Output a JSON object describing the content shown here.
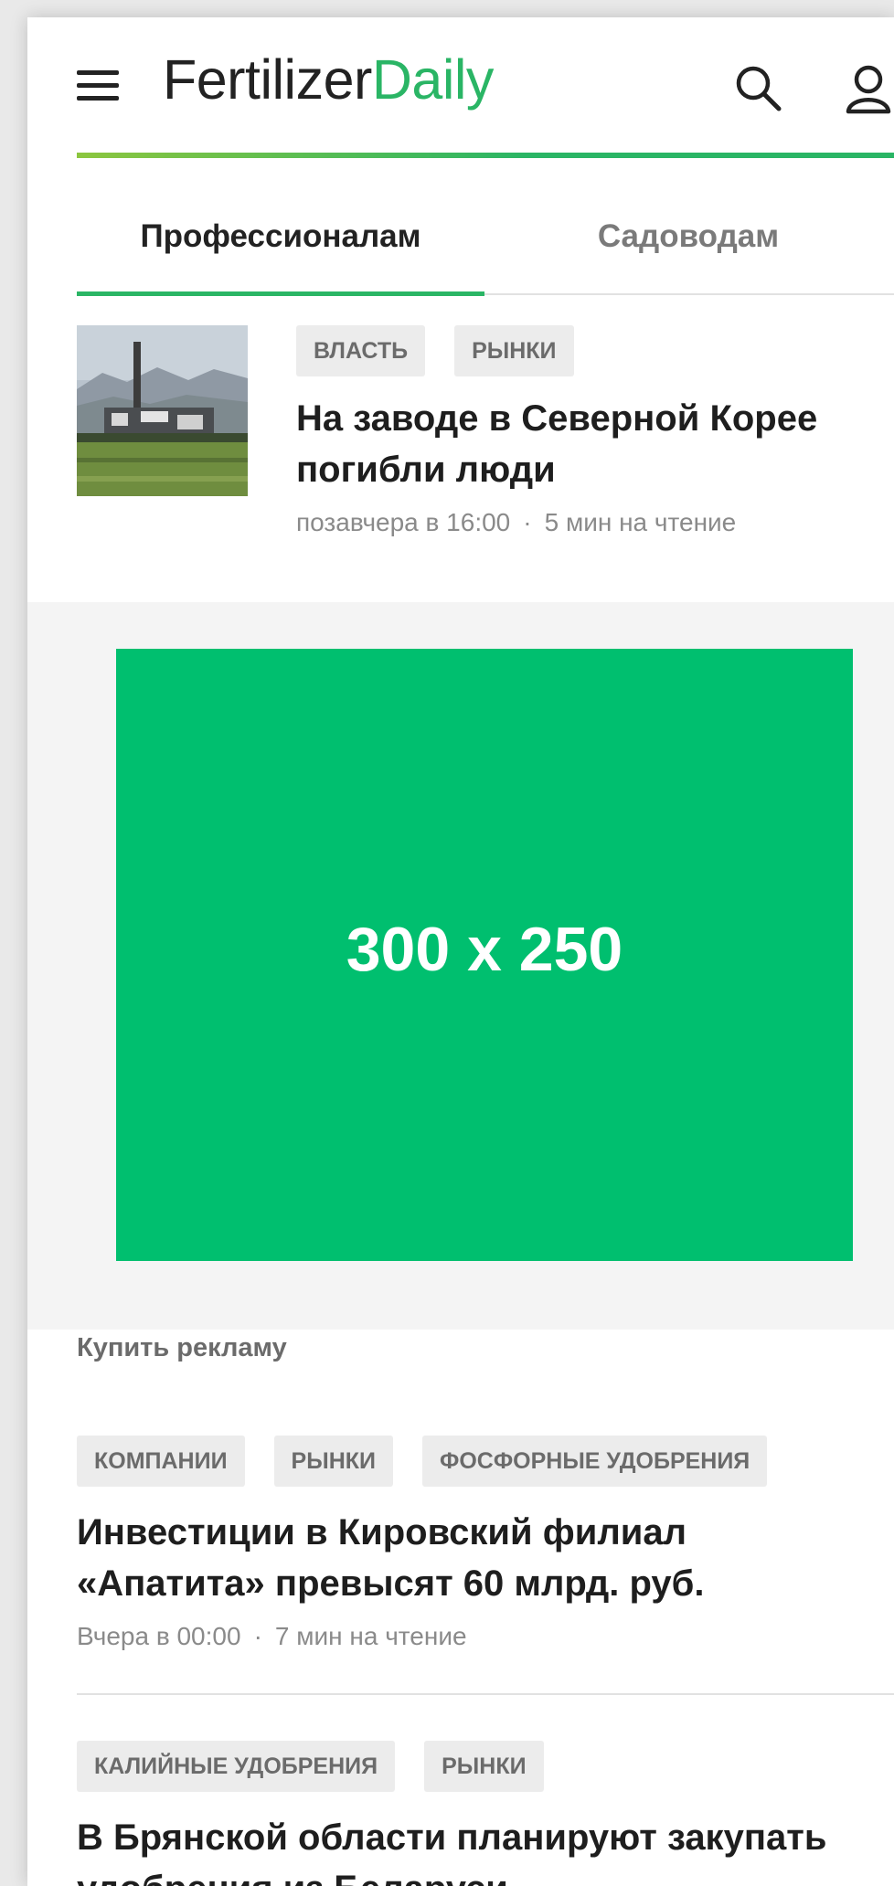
{
  "brand": {
    "name_part1": "Fertilizer",
    "name_part2": "Daily",
    "accent_color": "#2ab565"
  },
  "header": {
    "menu_icon": "hamburger-menu-icon",
    "search_icon": "search-icon",
    "profile_icon": "user-icon"
  },
  "tabs": [
    {
      "label": "Профессионалам",
      "active": true
    },
    {
      "label": "Садоводам",
      "active": false
    }
  ],
  "articles": [
    {
      "tags": [
        "ВЛАСТЬ",
        "РЫНКИ"
      ],
      "title": "На заводе в Северной Корее погибли люди",
      "date": "позавчера в 16:00",
      "read_time": "5 мин на чтение",
      "thumbnail": "factory-photo"
    },
    {
      "tags": [
        "КОМПАНИИ",
        "РЫНКИ",
        "ФОСФОРНЫЕ УДОБРЕНИЯ"
      ],
      "title": "Инвестиции в Кировский филиал «Апатита» превысят 60 млрд. руб.",
      "date": "Вчера в 00:00",
      "read_time": "7 мин на чтение"
    },
    {
      "tags": [
        "КАЛИЙНЫЕ УДОБРЕНИЯ",
        "РЫНКИ"
      ],
      "title": "В Брянской области планируют закупать удобрения из Беларуси"
    }
  ],
  "ad": {
    "placeholder": "300 x 250",
    "color": "#00bf6f",
    "buy_link": "Купить рекламу"
  },
  "meta_separator": "·"
}
